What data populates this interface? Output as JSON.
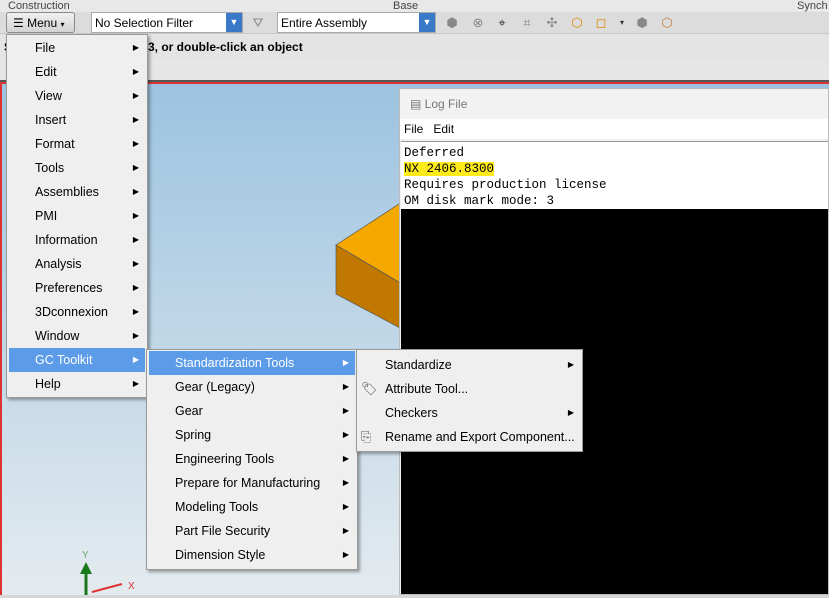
{
  "ribbon": {
    "groups": [
      "Construction",
      "Base",
      "Synch"
    ]
  },
  "toolbar": {
    "menu_label": "Menu",
    "selection_filter": "No Selection Filter",
    "scope": "Entire Assembly"
  },
  "status": {
    "prompt_left": "S",
    "prompt": "3, or double-click an object"
  },
  "log_window": {
    "title": "Log File",
    "menu": [
      "File",
      "Edit"
    ],
    "lines": [
      "Deferred",
      "NX 2406.8300",
      "Requires production license",
      "OM disk mark mode: 3"
    ],
    "highlight_color": "#ffeb1a"
  },
  "main_menu": {
    "items": [
      "File",
      "Edit",
      "View",
      "Insert",
      "Format",
      "Tools",
      "Assemblies",
      "PMI",
      "Information",
      "Analysis",
      "Preferences",
      "3Dconnexion",
      "Window",
      "GC Toolkit",
      "Help"
    ],
    "selected": "GC Toolkit"
  },
  "gc_menu": {
    "items": [
      "Standardization Tools",
      "Gear (Legacy)",
      "Gear",
      "Spring",
      "Engineering Tools",
      "Prepare for Manufacturing",
      "Modeling Tools",
      "Part File Security",
      "Dimension Style"
    ],
    "selected": "Standardization Tools"
  },
  "std_menu": {
    "items": [
      {
        "label": "Standardize",
        "submenu": true,
        "icon": ""
      },
      {
        "label": "Attribute Tool...",
        "submenu": false,
        "icon": "tag-icon"
      },
      {
        "label": "Checkers",
        "submenu": true,
        "icon": ""
      },
      {
        "label": "Rename and Export Component...",
        "submenu": false,
        "icon": "rename-export-icon"
      }
    ]
  },
  "axes": {
    "y": "Y",
    "x": "X"
  },
  "colors": {
    "highlight": "#5b9be8",
    "part_top": "#f5a800",
    "part_side": "#c07800"
  }
}
